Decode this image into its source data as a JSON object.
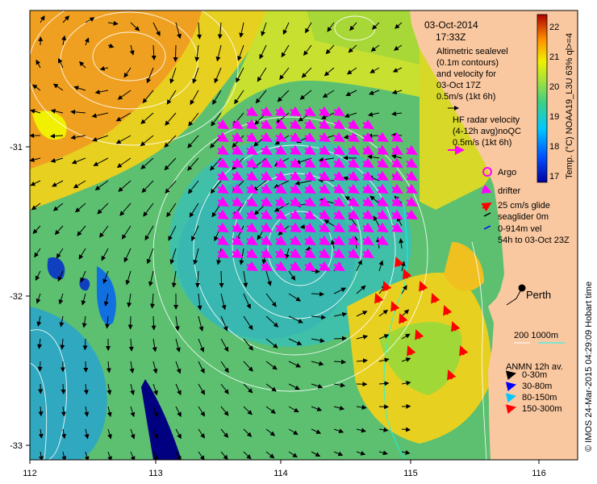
{
  "map": {
    "date": "03-Oct-2014",
    "time": "17:33Z",
    "altimetry_note": [
      "Altimetric sealevel",
      "(0.1m contours)",
      "and velocity for",
      "03-Oct 17Z"
    ],
    "altimetry_scale": "0.5m/s (1kt 6h)",
    "hf_note": [
      "HF radar velocity",
      "(4-12h avg)noQC"
    ],
    "hf_scale": "0.5m/s (1kt 6h)",
    "argo": "Argo",
    "drifter": "drifter",
    "glide": "25 cm/s glide",
    "seaglider": "seaglider 0m",
    "vel": "0-914m vel",
    "vel_time": "54h to 03-Oct 23Z",
    "city": "Perth",
    "isobaths": "200  1000m",
    "anmn_title": "ANMN 12h av.",
    "anmn_items": [
      {
        "label": "0-30m",
        "color": "#000000"
      },
      {
        "label": "30-80m",
        "color": "#0000ff"
      },
      {
        "label": "80-150m",
        "color": "#00c8ff"
      },
      {
        "label": "150-300m",
        "color": "#ff0000"
      }
    ],
    "credit": "© IMOS 24-Mar-2015 04:29:09 Hobart time",
    "colorbar_label": "Temp. (°C) NOAA19_L3U 63% ql>=4",
    "colorbar_ticks": [
      "22",
      "21",
      "20",
      "19",
      "18",
      "17"
    ],
    "x_ticks": [
      "112",
      "113",
      "114",
      "115",
      "116"
    ],
    "y_ticks": [
      "-31",
      "-32",
      "-33"
    ],
    "colors": {
      "land": "#fac8a0",
      "hf_arrow": "#ff00ff",
      "glide_arrow": "#ff0000",
      "marker": "#000000"
    }
  }
}
